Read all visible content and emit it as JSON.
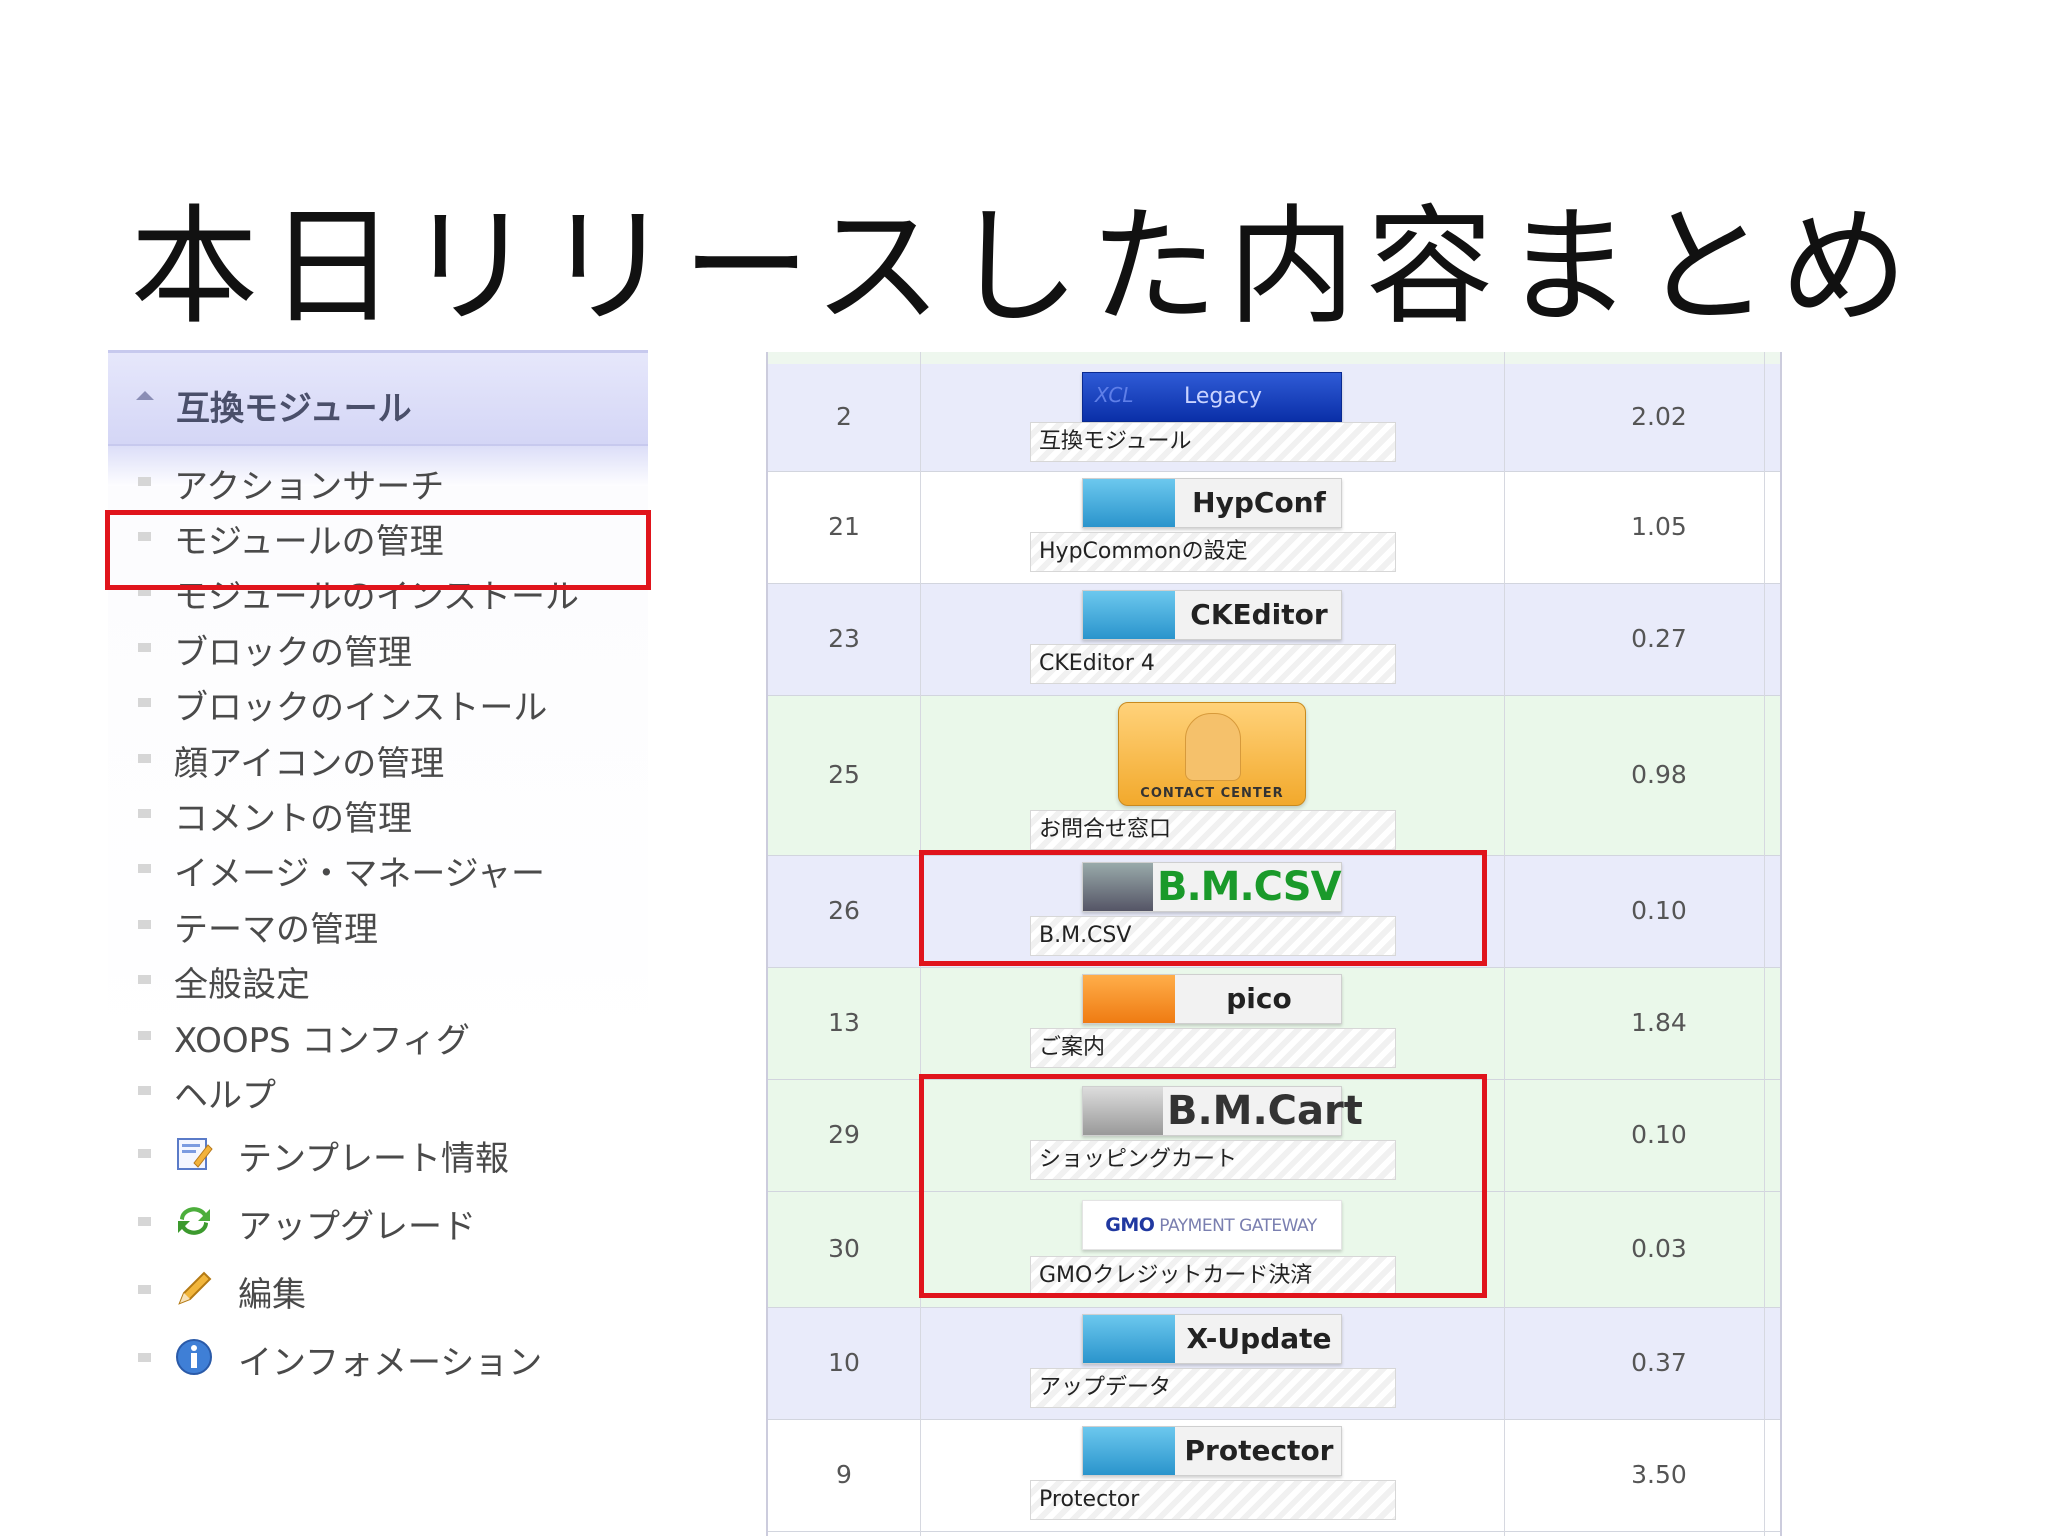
{
  "slide": {
    "title": "本日リリースした内容まとめ"
  },
  "sidebar": {
    "header": "互換モジュール",
    "items": [
      {
        "label": "アクションサーチ"
      },
      {
        "label": "モジュールの管理"
      },
      {
        "label": "モジュールのインストール"
      },
      {
        "label": "ブロックの管理"
      },
      {
        "label": "ブロックのインストール"
      },
      {
        "label": "顔アイコンの管理"
      },
      {
        "label": "コメントの管理"
      },
      {
        "label": "イメージ・マネージャー"
      },
      {
        "label": "テーマの管理"
      },
      {
        "label": "全般設定"
      },
      {
        "label": "XOOPS コンフィグ"
      },
      {
        "label": "ヘルプ"
      },
      {
        "label": "テンプレート情報",
        "icon": "template-icon"
      },
      {
        "label": "アップグレード",
        "icon": "refresh-icon"
      },
      {
        "label": "編集",
        "icon": "pencil-icon"
      },
      {
        "label": "インフォメーション",
        "icon": "info-icon"
      }
    ]
  },
  "modules": [
    {
      "mid": "2",
      "logo_text": "Legacy",
      "logo_sub": "XCL",
      "desc": "互換モジュール",
      "version": "2.02"
    },
    {
      "mid": "21",
      "logo_text": "HypConf",
      "desc": "HypCommonの設定",
      "version": "1.05"
    },
    {
      "mid": "23",
      "logo_text": "CKEditor 4",
      "desc": "CKEditor 4",
      "version": "0.27"
    },
    {
      "mid": "25",
      "logo_text": "CONTACT CENTER",
      "desc": "お問合せ窓口",
      "version": "0.98"
    },
    {
      "mid": "26",
      "logo_text": "B.M.CSV",
      "desc": "B.M.CSV",
      "version": "0.10"
    },
    {
      "mid": "13",
      "logo_text": "pico",
      "desc": "ご案内",
      "version": "1.84"
    },
    {
      "mid": "29",
      "logo_text": "B.M.Cart",
      "desc": "ショッピングカート",
      "version": "0.10"
    },
    {
      "mid": "30",
      "logo_text": "PAYMENT GATEWAY",
      "logo_sub": "GMO",
      "desc": "GMOクレジットカード決済",
      "version": "0.03"
    },
    {
      "mid": "10",
      "logo_text": "X-Update",
      "desc": "アップデータ",
      "version": "0.37"
    },
    {
      "mid": "9",
      "logo_text": "Protector",
      "desc": "Protector",
      "version": "3.50"
    }
  ],
  "colors": {
    "highlight": "#e0141c",
    "row_blue": "#e9ebfa",
    "row_green": "#eaf8ea"
  }
}
